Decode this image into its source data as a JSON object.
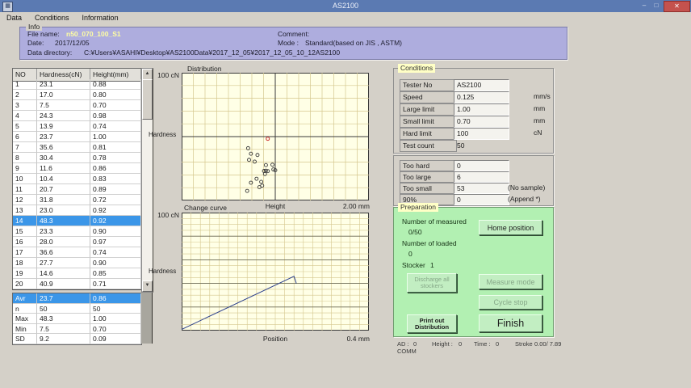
{
  "window": {
    "title": "AS2100",
    "minimize_glyph": "–",
    "maximize_glyph": "□",
    "close_glyph": "✕"
  },
  "icons": {
    "app_icon": "▦",
    "scroll_up": "▲",
    "scroll_down": "▼"
  },
  "menu": {
    "items": [
      "Data",
      "Conditions",
      "Information"
    ]
  },
  "info": {
    "caption": "Info",
    "file_name_label": "File name:",
    "file_name": "n50_070_100_S1",
    "date_label": "Date:",
    "date": "2017/12/05",
    "dir_label": "Data directory:",
    "dir": "C:¥Users¥ASAHI¥Desktop¥AS2100Data¥2017_12_05¥2017_12_05_10_12AS2100",
    "comment_label": "Comment:",
    "comment": "",
    "mode_label": "Mode :",
    "mode": "Standard(based on JIS , ASTM)"
  },
  "results_table": {
    "headers": [
      "NO",
      "Hardness(cN)",
      "Height(mm)"
    ],
    "selected_no": 14,
    "rows": [
      [
        1,
        "23.1",
        "0.88"
      ],
      [
        2,
        "17.0",
        "0.80"
      ],
      [
        3,
        "7.5",
        "0.70"
      ],
      [
        4,
        "24.3",
        "0.98"
      ],
      [
        5,
        "13.9",
        "0.74"
      ],
      [
        6,
        "23.7",
        "1.00"
      ],
      [
        7,
        "35.6",
        "0.81"
      ],
      [
        8,
        "30.4",
        "0.78"
      ],
      [
        9,
        "11.6",
        "0.86"
      ],
      [
        10,
        "10.4",
        "0.83"
      ],
      [
        11,
        "20.7",
        "0.89"
      ],
      [
        12,
        "31.8",
        "0.72"
      ],
      [
        13,
        "23.0",
        "0.92"
      ],
      [
        14,
        "48.3",
        "0.92"
      ],
      [
        15,
        "23.3",
        "0.90"
      ],
      [
        16,
        "28.0",
        "0.97"
      ],
      [
        17,
        "36.6",
        "0.74"
      ],
      [
        18,
        "27.7",
        "0.90"
      ],
      [
        19,
        "14.6",
        "0.85"
      ],
      [
        20,
        "40.9",
        "0.71"
      ]
    ],
    "summary": [
      [
        "Avr",
        "23.7",
        "0.86"
      ],
      [
        "n",
        "50",
        "50"
      ],
      [
        "Max",
        "48.3",
        "1.00"
      ],
      [
        "Min",
        "7.5",
        "0.70"
      ],
      [
        "SD",
        "9.2",
        "0.09"
      ]
    ],
    "summary_selected": "Avr"
  },
  "conditions_panel": {
    "caption": "Conditions",
    "rows": [
      {
        "label": "Tester No",
        "value": "AS2100",
        "unit": "",
        "boxed": true
      },
      {
        "label": "Speed",
        "value": "0.125",
        "unit": "mm/s",
        "boxed": true
      },
      {
        "label": "Large limit",
        "value": "1.00",
        "unit": "mm",
        "boxed": true
      },
      {
        "label": "Small limit",
        "value": "0.70",
        "unit": "mm",
        "boxed": true
      },
      {
        "label": "Hard limit",
        "value": "100",
        "unit": "cN",
        "boxed": true
      },
      {
        "label": "Test count",
        "value": "50",
        "unit": "",
        "boxed": false
      }
    ]
  },
  "limits_panel": {
    "rows": [
      {
        "label": "Too hard",
        "value": "0",
        "note": ""
      },
      {
        "label": "Too large",
        "value": "6",
        "note": ""
      },
      {
        "label": "Too small",
        "value": "53",
        "note": "(No sample)"
      },
      {
        "label": "90%",
        "value": "0",
        "note": "(Append *)"
      }
    ]
  },
  "preparation_panel": {
    "caption": "Preparation",
    "measured_label": "Number of measured",
    "measured_value": "0/50",
    "loaded_label": "Number of loaded",
    "loaded_value": "0",
    "stocker_label": "Stocker",
    "stocker_value": "1",
    "buttons": {
      "home": {
        "label": "Home position",
        "enabled": true
      },
      "discharge": {
        "label": "Discharge all stockers",
        "enabled": false
      },
      "measure": {
        "label": "Measure mode",
        "enabled": false
      },
      "cycle": {
        "label": "Cycle stop",
        "enabled": false
      },
      "print": {
        "label": "Print out Distribution",
        "enabled": true
      },
      "finish": {
        "label": "Finish",
        "enabled": true
      }
    }
  },
  "status_bar": {
    "ad_label": "AD :",
    "ad_value": "0",
    "height_label": "Height :",
    "height_value": "0",
    "time_label": "Time :",
    "time_value": "0",
    "stroke_label": "Stroke",
    "stroke_value": "0.00/ 7.89",
    "comm": "COMM"
  },
  "chart_data": [
    {
      "type": "scatter",
      "title": "Distribution",
      "xlabel": "Height",
      "ylabel": "Hardness",
      "y_top_label": "100 cN",
      "x_end_label": "2.00 mm",
      "xlim": [
        0,
        2
      ],
      "ylim": [
        0,
        100
      ],
      "grid": {
        "x_divisions": 16,
        "y_divisions": 10
      },
      "reference_lines": {
        "horizontal_cN": 50,
        "vertical_mm": 1.0
      },
      "points": [
        [
          0.88,
          23.1
        ],
        [
          0.8,
          17.0
        ],
        [
          0.7,
          7.5
        ],
        [
          0.98,
          24.3
        ],
        [
          0.74,
          13.9
        ],
        [
          1.0,
          23.7
        ],
        [
          0.81,
          35.6
        ],
        [
          0.78,
          30.4
        ],
        [
          0.86,
          11.6
        ],
        [
          0.83,
          10.4
        ],
        [
          0.89,
          20.7
        ],
        [
          0.72,
          31.8
        ],
        [
          0.92,
          23.0
        ],
        [
          0.9,
          23.3
        ],
        [
          0.97,
          28.0
        ],
        [
          0.74,
          36.6
        ],
        [
          0.9,
          27.7
        ],
        [
          0.85,
          14.6
        ],
        [
          0.71,
          40.9
        ]
      ],
      "highlight_point": [
        0.92,
        48.3
      ]
    },
    {
      "type": "line",
      "title": "Change curve",
      "xlabel": "Position",
      "ylabel": "Hardness",
      "y_top_label": "100 cN",
      "x_end_label": "0.4  mm",
      "xlim": [
        0,
        0.4
      ],
      "ylim": [
        0,
        100
      ],
      "grid": {
        "x_divisions": 20,
        "y_divisions": 20,
        "y_major_every": 4
      },
      "points": [
        [
          0,
          1
        ],
        [
          0.24,
          46
        ],
        [
          0.245,
          40
        ]
      ]
    }
  ],
  "colors": {
    "titlebar": "#5b7ab2",
    "close_button": "#c4524e",
    "selection_blue": "#3b96e8",
    "info_panel": "#aeadde",
    "file_name_text": "#ffffa2",
    "chart_background": "#ffffe6",
    "chart_grid": "#d5c78e",
    "chart_axis": "#3a3a3a",
    "curve_line": "#2b3f8c",
    "scatter_point": "#3a3a3a",
    "scatter_highlight": "#cc3333",
    "preparation_panel": "#b2f0b2",
    "caption_highlight": "#ffffc6",
    "window_background": "#d4d0c8"
  }
}
